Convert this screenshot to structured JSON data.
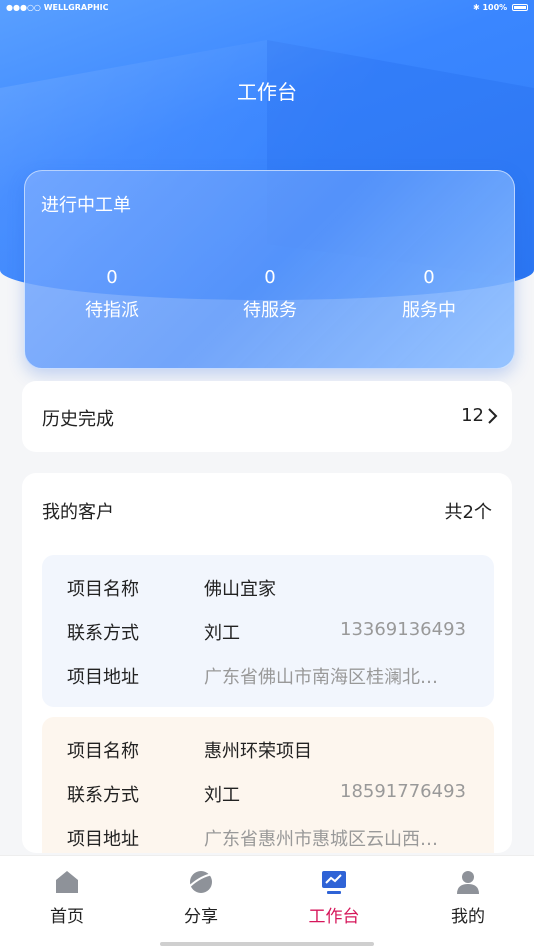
{
  "status_bar": {
    "carrier": "●●●○○ WELLGRAPHIC",
    "battery": "100%",
    "bluetooth_icon": "bluetooth-icon"
  },
  "header": {
    "title": "工作台"
  },
  "in_progress": {
    "title": "进行中工单",
    "stats": [
      {
        "value": "0",
        "label": "待指派"
      },
      {
        "value": "0",
        "label": "待服务"
      },
      {
        "value": "0",
        "label": "服务中"
      }
    ]
  },
  "history": {
    "label": "历史完成",
    "value": "12"
  },
  "customers": {
    "label": "我的客户",
    "count": "共2个",
    "items": [
      {
        "name_key": "项目名称",
        "name": "佛山宜家",
        "contact_key": "联系方式",
        "contact": "刘工",
        "phone": "13369136493",
        "address_key": "项目地址",
        "address": "广东省佛山市南海区桂澜北…"
      },
      {
        "name_key": "项目名称",
        "name": "惠州环荣项目",
        "contact_key": "联系方式",
        "contact": "刘工",
        "phone": "18591776493",
        "address_key": "项目地址",
        "address": "广东省惠州市惠城区云山西…"
      }
    ]
  },
  "tabbar": {
    "tabs": [
      {
        "label": "首页",
        "icon": "home-icon"
      },
      {
        "label": "分享",
        "icon": "planet-icon"
      },
      {
        "label": "工作台",
        "icon": "monitor-chart-icon",
        "active": true
      },
      {
        "label": "我的",
        "icon": "user-icon"
      }
    ]
  },
  "colors": {
    "accent": "#d6175b",
    "hero_blue": "#3a86ff"
  }
}
